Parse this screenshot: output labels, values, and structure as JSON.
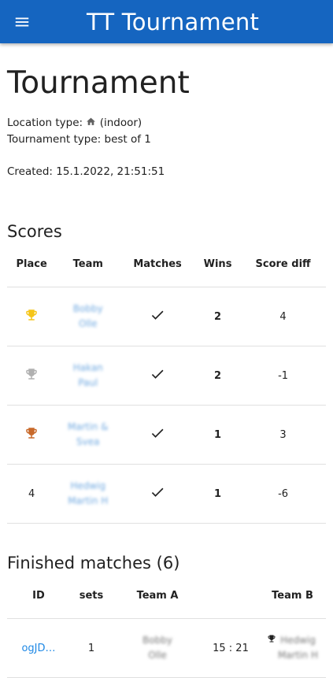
{
  "appbar": {
    "title": "TT Tournament",
    "menu_icon": "hamburger-icon"
  },
  "page": {
    "title": "Tournament",
    "location_label": "Location type:",
    "location_value": "(indoor)",
    "tournament_type": "Tournament type: best of 1",
    "created": "Created: 15.1.2022, 21:51:51"
  },
  "scores": {
    "title": "Scores",
    "headers": [
      "Place",
      "Team",
      "Matches",
      "Wins",
      "Score diff"
    ],
    "rows": [
      {
        "place": "",
        "medal": "gold",
        "team_line1": "Bobby",
        "team_line2": "Olle",
        "wins": "2",
        "diff": "4"
      },
      {
        "place": "",
        "medal": "silver",
        "team_line1": "Hakan",
        "team_line2": "Paul",
        "wins": "2",
        "diff": "-1"
      },
      {
        "place": "",
        "medal": "bronze",
        "team_line1": "Martin &",
        "team_line2": "Svea",
        "wins": "1",
        "diff": "3"
      },
      {
        "place": "4",
        "medal": "none",
        "team_line1": "Hedwig",
        "team_line2": "Martin H",
        "wins": "1",
        "diff": "-6"
      }
    ],
    "colors": {
      "gold": "#f5c518",
      "silver": "#b0b0b0",
      "bronze": "#c8692a"
    }
  },
  "finished": {
    "title": "Finished matches (6)",
    "headers": [
      "ID",
      "sets",
      "Team A",
      "",
      "Team B"
    ],
    "rows": [
      {
        "id": "ogJD…",
        "sets": "1",
        "team_a_line1": "Bobby",
        "team_a_line2": "Olle",
        "score": "15 : 21",
        "team_b_line1": "Hedwig",
        "team_b_line2": "Martin H"
      }
    ]
  }
}
